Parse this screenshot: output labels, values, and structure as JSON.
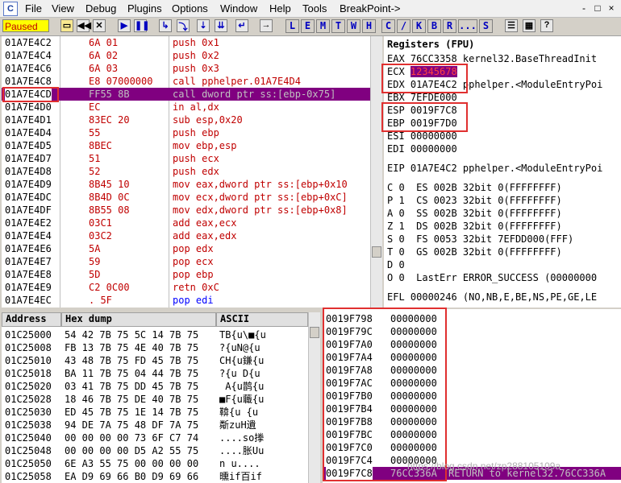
{
  "menubar": {
    "app_icon": "C",
    "items": [
      "File",
      "View",
      "Debug",
      "Plugins",
      "Options",
      "Window",
      "Help",
      "Tools",
      "BreakPoint->"
    ],
    "window_buttons": [
      "-",
      "□",
      "×"
    ]
  },
  "toolbar": {
    "status": "Paused",
    "icons": [
      "open-icon",
      "rewind-icon",
      "close-icon",
      "run-icon",
      "pause-icon",
      "step-into-icon",
      "step-over-icon",
      "trace-into-icon",
      "trace-over-icon",
      "execute-till-return-icon",
      "goto-icon"
    ],
    "letters": [
      "L",
      "E",
      "M",
      "T",
      "W",
      "H",
      "C",
      "/",
      "K",
      "B",
      "R",
      "...",
      "S"
    ],
    "right_icons": [
      "list-icon",
      "grid-icon",
      "help-icon"
    ]
  },
  "disasm": {
    "rows": [
      {
        "addr": "01A7E4C2",
        "hex": "6A 01",
        "dis": "push 0x1"
      },
      {
        "addr": "01A7E4C4",
        "hex": "6A 02",
        "dis": "push 0x2"
      },
      {
        "addr": "01A7E4C6",
        "hex": "6A 03",
        "dis": "push 0x3"
      },
      {
        "addr": "01A7E4C8",
        "hex": "E8 07000000",
        "dis": "call pphelper.01A7E4D4"
      },
      {
        "addr": "01A7E4CD",
        "hex": "FF55 8B",
        "dis": "call dword ptr ss:[ebp-0x75]"
      },
      {
        "addr": "01A7E4D0",
        "hex": "EC",
        "dis": "in al,dx"
      },
      {
        "addr": "01A7E4D1",
        "hex": "83EC 20",
        "dis": "sub esp,0x20"
      },
      {
        "addr": "01A7E4D4",
        "hex": "55",
        "dis": "push ebp"
      },
      {
        "addr": "01A7E4D5",
        "hex": "8BEC",
        "dis": "mov ebp,esp"
      },
      {
        "addr": "01A7E4D7",
        "hex": "51",
        "dis": "push ecx"
      },
      {
        "addr": "01A7E4D8",
        "hex": "52",
        "dis": "push edx"
      },
      {
        "addr": "01A7E4D9",
        "hex": "8B45 10",
        "dis": "mov eax,dword ptr ss:[ebp+0x10"
      },
      {
        "addr": "01A7E4DC",
        "hex": "8B4D 0C",
        "dis": "mov ecx,dword ptr ss:[ebp+0xC]"
      },
      {
        "addr": "01A7E4DF",
        "hex": "8B55 08",
        "dis": "mov edx,dword ptr ss:[ebp+0x8]"
      },
      {
        "addr": "01A7E4E2",
        "hex": "03C1",
        "dis": "add eax,ecx"
      },
      {
        "addr": "01A7E4E4",
        "hex": "03C2",
        "dis": "add eax,edx"
      },
      {
        "addr": "01A7E4E6",
        "hex": "5A",
        "dis": "pop edx"
      },
      {
        "addr": "01A7E4E7",
        "hex": "59",
        "dis": "pop ecx"
      },
      {
        "addr": "01A7E4E8",
        "hex": "5D",
        "dis": "pop ebp"
      },
      {
        "addr": "01A7E4E9",
        "hex": "C2 0C00",
        "dis": "retn 0xC"
      },
      {
        "addr": "01A7E4EC",
        "hex": ". 5F",
        "dis": "pop edi"
      }
    ]
  },
  "registers": {
    "title": "Registers (FPU)",
    "lines": [
      "EAX 76CC3358 kernel32.BaseThreadInit",
      "ECX 12345678",
      "EDX 01A7E4C2 pphelper.<ModuleEntryPoi",
      "EBX 7EFDE000",
      "ESP 0019F7C8",
      "EBP 0019F7D0",
      "ESI 00000000",
      "EDI 00000000",
      "",
      "EIP 01A7E4C2 pphelper.<ModuleEntryPoi",
      "",
      "C 0  ES 002B 32bit 0(FFFFFFFF)",
      "P 1  CS 0023 32bit 0(FFFFFFFF)",
      "A 0  SS 002B 32bit 0(FFFFFFFF)",
      "Z 1  DS 002B 32bit 0(FFFFFFFF)",
      "S 0  FS 0053 32bit 7EFDD000(FFF)",
      "T 0  GS 002B 32bit 0(FFFFFFFF)",
      "D 0",
      "O 0  LastErr ERROR_SUCCESS (00000000",
      "",
      "EFL 00000246 (NO,NB,E,BE,NS,PE,GE,LE"
    ]
  },
  "dump": {
    "headers": [
      "Address",
      "Hex dump",
      "ASCII"
    ],
    "rows": [
      {
        "addr": "01C25000",
        "hex": "54 42 7B 75 5C 14 7B 75",
        "ascii": "TB{u\\■{u"
      },
      {
        "addr": "01C25008",
        "hex": "FB 13 7B 75 4E 40 7B 75",
        "ascii": "?{uN@{u"
      },
      {
        "addr": "01C25010",
        "hex": "43 48 7B 75 FD 45 7B 75",
        "ascii": "CH{u鎌{u"
      },
      {
        "addr": "01C25018",
        "hex": "BA 11 7B 75 04 44 7B 75",
        "ascii": "?{u D{u"
      },
      {
        "addr": "01C25020",
        "hex": "03 41 7B 75 DD 45 7B 75",
        "ascii": " A{u鹊{u"
      },
      {
        "addr": "01C25028",
        "hex": "18 46 7B 75 DE 40 7B 75",
        "ascii": "■F{u蘵{u"
      },
      {
        "addr": "01C25030",
        "hex": "ED 45 7B 75 1E 14 7B 75",
        "ascii": "鞥{u {u"
      },
      {
        "addr": "01C25038",
        "hex": "94 DE 7A 75 48 DF 7A 75",
        "ascii": "斴zuH遺"
      },
      {
        "addr": "01C25040",
        "hex": "00 00 00 00 73 6F C7 74",
        "ascii": "....so搼"
      },
      {
        "addr": "01C25048",
        "hex": "00 00 00 00 D5 A2 55 75",
        "ascii": "....胀Uu"
      },
      {
        "addr": "01C25050",
        "hex": "6E A3 55 75 00 00 00 00",
        "ascii": "n u...."
      },
      {
        "addr": "01C25058",
        "hex": "EA D9 69 66 B0 D9 69 66",
        "ascii": "曛if百if"
      }
    ]
  },
  "stack": {
    "rows": [
      {
        "addr": "0019F798",
        "val": "00000000",
        "comment": ""
      },
      {
        "addr": "0019F79C",
        "val": "00000000",
        "comment": ""
      },
      {
        "addr": "0019F7A0",
        "val": "00000000",
        "comment": ""
      },
      {
        "addr": "0019F7A4",
        "val": "00000000",
        "comment": ""
      },
      {
        "addr": "0019F7A8",
        "val": "00000000",
        "comment": ""
      },
      {
        "addr": "0019F7AC",
        "val": "00000000",
        "comment": ""
      },
      {
        "addr": "0019F7B0",
        "val": "00000000",
        "comment": ""
      },
      {
        "addr": "0019F7B4",
        "val": "00000000",
        "comment": ""
      },
      {
        "addr": "0019F7B8",
        "val": "00000000",
        "comment": ""
      },
      {
        "addr": "0019F7BC",
        "val": "00000000",
        "comment": ""
      },
      {
        "addr": "0019F7C0",
        "val": "00000000",
        "comment": ""
      },
      {
        "addr": "0019F7C4",
        "val": "00000000",
        "comment": ""
      },
      {
        "addr": "0019F7C8",
        "val": "76CC336A",
        "comment": "RETURN to kernel32.76CC336A"
      }
    ]
  },
  "watermark": "https://blog.csdn.net/zp288105109a",
  "colors": {
    "accent_red": "#e03030",
    "selection": "#800080",
    "status_bg": "#ffff00",
    "code_red": "#c00000",
    "code_blue": "#0000ff"
  }
}
